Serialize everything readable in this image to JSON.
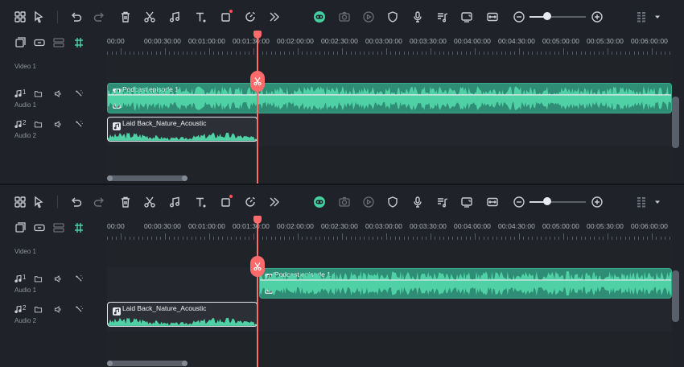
{
  "timeline": {
    "ruler_labels": [
      "00:00",
      "00:00:30:00",
      "00:01:00:00",
      "00:01:30:00",
      "00:02:00:00",
      "00:02:30:00",
      "00:03:00:00",
      "00:03:30:00",
      "00:04:00:00",
      "00:04:30:00",
      "00:05:00:00",
      "00:05:30:00",
      "00:06:00:00"
    ],
    "tracks": {
      "video1": {
        "name": "Video 1"
      },
      "audio1": {
        "name": "Audio 1",
        "number": "1"
      },
      "audio2": {
        "name": "Audio 2",
        "number": "2"
      }
    }
  },
  "before": {
    "podcast_clip": {
      "title": "Podcast episode 1"
    },
    "music_clip": {
      "title": "Laid Back_Nature_Acoustic"
    }
  },
  "after": {
    "podcast_clip": {
      "title": "Podcast episode 1"
    },
    "music_clip": {
      "title": "Laid Back_Nature_Acoustic"
    }
  },
  "toolbar_icons": [
    "layout-grid-icon",
    "select-arrow-icon",
    "undo-icon",
    "redo-icon",
    "delete-icon",
    "scissors-icon",
    "audio-note-icon",
    "text-tool-icon",
    "crop-icon",
    "speed-icon",
    "more-icon",
    "ai-face-icon",
    "snapshot-icon",
    "play-circle-icon",
    "shield-icon",
    "microphone-icon",
    "music-list-icon",
    "screen-icon",
    "fit-icon",
    "zoom-out-icon",
    "zoom-in-icon",
    "grid-view-icon",
    "dropdown-icon"
  ],
  "colors": {
    "playhead": "#ff6b6b",
    "podcast_clip": "#2e8d74",
    "waveform": "#4fd1a5",
    "panel_bg": "#1f2228"
  }
}
